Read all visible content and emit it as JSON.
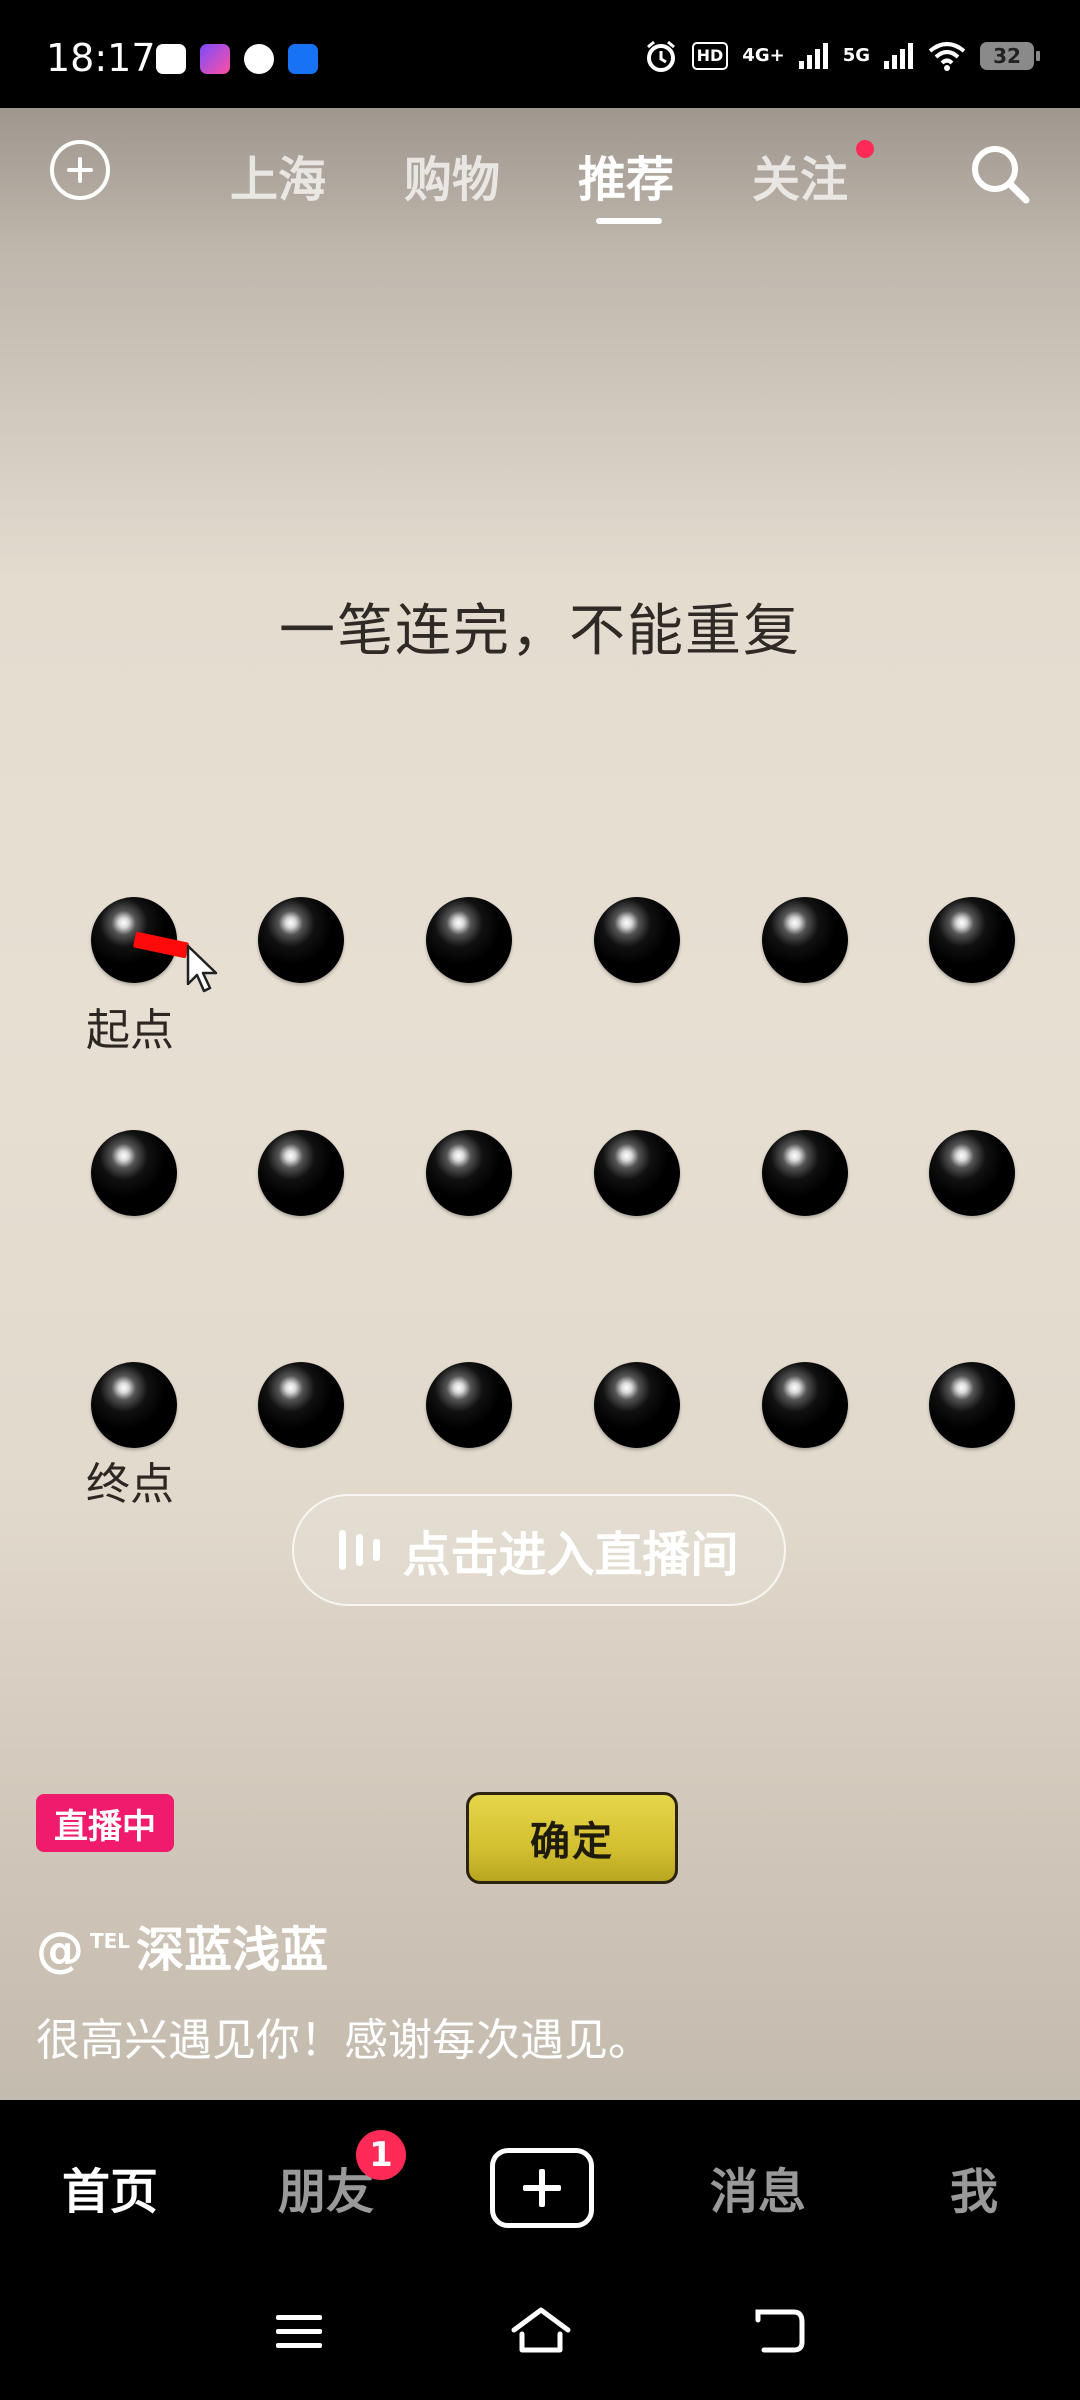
{
  "status_bar": {
    "time": "18:17",
    "network_hd": "HD",
    "network_4g": "4G+",
    "network_5g": "5G",
    "battery": "32"
  },
  "top_nav": {
    "tabs": [
      {
        "label": "上海",
        "active": false
      },
      {
        "label": "购物",
        "active": false
      },
      {
        "label": "推荐",
        "active": true
      },
      {
        "label": "关注",
        "active": false,
        "has_dot": true
      }
    ]
  },
  "video": {
    "rule_text": "一笔连完，不能重复",
    "start_label": "起点",
    "end_label": "终点",
    "enter_live_text": "点击进入直播间",
    "live_badge": "直播中",
    "confirm_label": "确定",
    "author": "@",
    "author_tag": "TEL",
    "author_name": "深蓝浅蓝",
    "caption": "很高兴遇见你！感谢每次遇见。"
  },
  "bottom_nav": {
    "items": [
      {
        "label": "首页",
        "active": true
      },
      {
        "label": "朋友",
        "active": false,
        "badge": "1"
      },
      {
        "label": "消息",
        "active": false
      },
      {
        "label": "我",
        "active": false
      }
    ]
  },
  "colors": {
    "accent_red": "#ff2a55",
    "live_pink": "#f01b6c",
    "confirm_yellow": "#d4c030"
  }
}
